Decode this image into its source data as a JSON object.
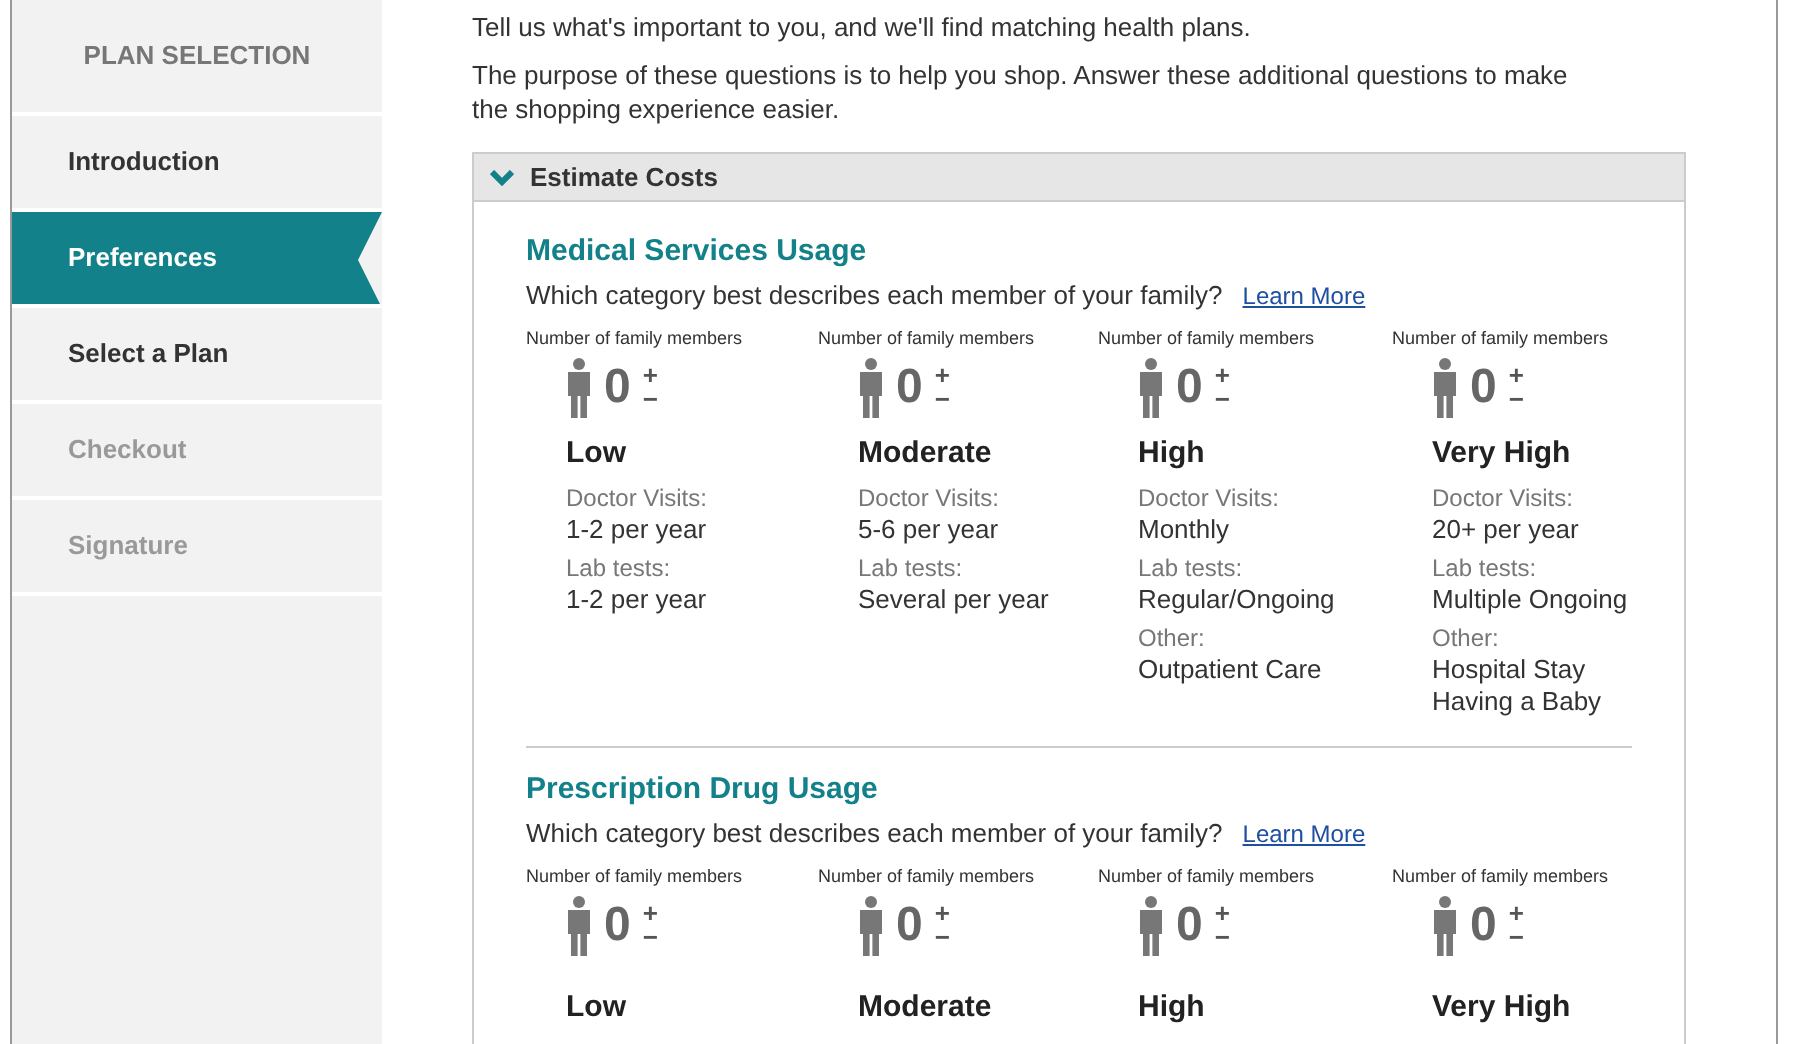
{
  "sidebar": {
    "heading": "PLAN SELECTION",
    "items": [
      {
        "label": "Introduction",
        "selected": false,
        "disabled": false
      },
      {
        "label": "Preferences",
        "selected": true,
        "disabled": false
      },
      {
        "label": "Select a Plan",
        "selected": false,
        "disabled": false
      },
      {
        "label": "Checkout",
        "selected": false,
        "disabled": true
      },
      {
        "label": "Signature",
        "selected": false,
        "disabled": true
      }
    ]
  },
  "intro": [
    "Tell us what's important to you, and we'll find matching health plans.",
    "The purpose of these questions is to help you shop. Answer these additional questions to make the shopping experience easier."
  ],
  "panel": {
    "title": "Estimate Costs",
    "expanded": true,
    "sections": [
      {
        "heading": "Medical Services Usage",
        "question": "Which category best describes each member of your family?",
        "link": "Learn More",
        "categories": [
          {
            "counter_label": "Number of family members",
            "count": "0",
            "plus": "+",
            "minus": "−",
            "name": "Low",
            "details": [
              {
                "label": "Doctor Visits:",
                "lines": [
                  "1-2 per year"
                ]
              },
              {
                "label": "Lab tests:",
                "lines": [
                  "1-2 per year"
                ]
              }
            ]
          },
          {
            "counter_label": "Number of family members",
            "count": "0",
            "plus": "+",
            "minus": "−",
            "name": "Moderate",
            "details": [
              {
                "label": "Doctor Visits:",
                "lines": [
                  "5-6 per year"
                ]
              },
              {
                "label": "Lab tests:",
                "lines": [
                  "Several per year"
                ]
              }
            ]
          },
          {
            "counter_label": "Number of family members",
            "count": "0",
            "plus": "+",
            "minus": "−",
            "name": "High",
            "details": [
              {
                "label": "Doctor Visits:",
                "lines": [
                  "Monthly"
                ]
              },
              {
                "label": "Lab tests:",
                "lines": [
                  "Regular/Ongoing"
                ]
              },
              {
                "label": "Other:",
                "lines": [
                  "Outpatient Care"
                ]
              }
            ]
          },
          {
            "counter_label": "Number of family members",
            "count": "0",
            "plus": "+",
            "minus": "−",
            "name": "Very High",
            "details": [
              {
                "label": "Doctor Visits:",
                "lines": [
                  "20+ per year"
                ]
              },
              {
                "label": "Lab tests:",
                "lines": [
                  "Multiple Ongoing"
                ]
              },
              {
                "label": "Other:",
                "lines": [
                  "Hospital Stay",
                  "Having a Baby"
                ]
              }
            ]
          }
        ]
      },
      {
        "heading": "Prescription Drug Usage",
        "question": "Which category best describes each member of your family?",
        "link": "Learn More",
        "categories": [
          {
            "counter_label": "Number of family members",
            "count": "0",
            "plus": "+",
            "minus": "−",
            "name": "Low"
          },
          {
            "counter_label": "Number of family members",
            "count": "0",
            "plus": "+",
            "minus": "−",
            "name": "Moderate"
          },
          {
            "counter_label": "Number of family members",
            "count": "0",
            "plus": "+",
            "minus": "−",
            "name": "High"
          },
          {
            "counter_label": "Number of family members",
            "count": "0",
            "plus": "+",
            "minus": "−",
            "name": "Very High"
          }
        ]
      }
    ]
  }
}
